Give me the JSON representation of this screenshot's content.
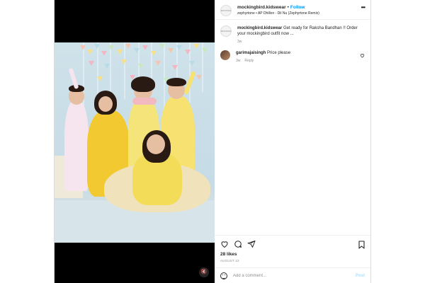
{
  "post": {
    "author": "mockingbird.kidswear",
    "separator": "•",
    "follow_label": "Follow",
    "audio": "zephyrtone • AP Dhillon - Dil Nu (Zephyrtone Remix)",
    "more_icon": "more-horizontal-icon",
    "avatar_text": "MOCKING"
  },
  "caption": {
    "author": "mockingbird.kidswear",
    "text": "Get ready for Raksha Bandhan !! Order your mockingbird outfit now ...",
    "time": "3w"
  },
  "comments": [
    {
      "author": "garimajaisingh",
      "text": "Price please",
      "time": "3w",
      "reply_label": "Reply"
    }
  ],
  "actions": {
    "like_icon": "heart-icon",
    "comment_icon": "comment-icon",
    "share_icon": "share-icon",
    "save_icon": "bookmark-icon"
  },
  "likes": "28 likes",
  "date": "AUGUST 22",
  "add_comment": {
    "placeholder": "Add a comment...",
    "post_label": "Post",
    "post_color": "#b2dffc"
  },
  "media": {
    "mute_icon": "volume-muted-icon"
  },
  "colors": {
    "follow": "#0095f6",
    "muted_text": "#8e8e8e",
    "border": "#dbdbdb"
  }
}
